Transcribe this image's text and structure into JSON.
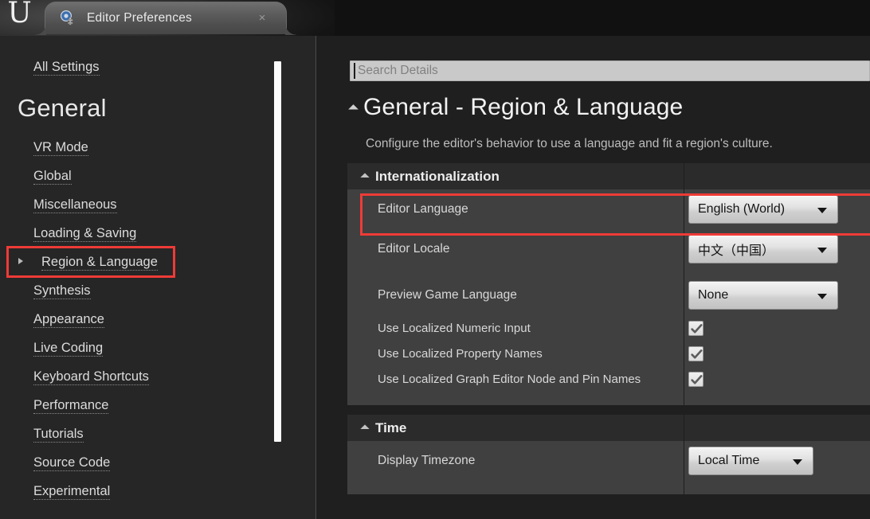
{
  "window": {
    "logo_glyph": "U",
    "tab": {
      "title": "Editor Preferences",
      "close_label": "×",
      "icon": "editor-preferences-icon"
    }
  },
  "sidebar": {
    "top_items": [
      {
        "label": "All Settings",
        "expandable": false,
        "selected": false
      }
    ],
    "group_title": "General",
    "items": [
      {
        "label": "VR Mode",
        "expandable": false,
        "selected": false
      },
      {
        "label": "Global",
        "expandable": false,
        "selected": false
      },
      {
        "label": "Miscellaneous",
        "expandable": false,
        "selected": false
      },
      {
        "label": "Loading & Saving",
        "expandable": false,
        "selected": false
      },
      {
        "label": "Region & Language",
        "expandable": true,
        "selected": true
      },
      {
        "label": "Synthesis",
        "expandable": false,
        "selected": false
      },
      {
        "label": "Appearance",
        "expandable": false,
        "selected": false
      },
      {
        "label": "Live Coding",
        "expandable": false,
        "selected": false
      },
      {
        "label": "Keyboard Shortcuts",
        "expandable": false,
        "selected": false
      },
      {
        "label": "Performance",
        "expandable": false,
        "selected": false
      },
      {
        "label": "Tutorials",
        "expandable": false,
        "selected": false
      },
      {
        "label": "Source Code",
        "expandable": false,
        "selected": false
      },
      {
        "label": "Experimental",
        "expandable": false,
        "selected": false
      }
    ]
  },
  "main": {
    "search": {
      "value": "",
      "placeholder": "Search Details"
    },
    "page_title": "General - Region & Language",
    "page_subtitle": "Configure the editor's behavior to use a language and fit a region's culture.",
    "sections": [
      {
        "title": "Internationalization",
        "rows": [
          {
            "label": "Editor Language",
            "type": "dropdown",
            "value": "English (World)",
            "width": "wide",
            "highlighted": true
          },
          {
            "label": "Editor Locale",
            "type": "dropdown",
            "value": "中文（中国）",
            "width": "wide",
            "highlighted": false
          },
          {
            "label": "Preview Game Language",
            "type": "dropdown",
            "value": "None",
            "width": "wide",
            "highlighted": false
          },
          {
            "label": "Use Localized Numeric Input",
            "type": "checkbox",
            "checked": true
          },
          {
            "label": "Use Localized Property Names",
            "type": "checkbox",
            "checked": true
          },
          {
            "label": "Use Localized Graph Editor Node and Pin Names",
            "type": "checkbox",
            "checked": true
          }
        ]
      },
      {
        "title": "Time",
        "rows": [
          {
            "label": "Display Timezone",
            "type": "dropdown",
            "value": "Local Time",
            "width": "narrow",
            "highlighted": false
          }
        ]
      }
    ]
  },
  "colors": {
    "highlight_red": "#ee3b37",
    "panel_bg": "#1f1f1f",
    "row_bg": "#404040",
    "section_bg": "#2b2b2b",
    "sidebar_bg": "#262626",
    "combo_text": "#141414"
  }
}
